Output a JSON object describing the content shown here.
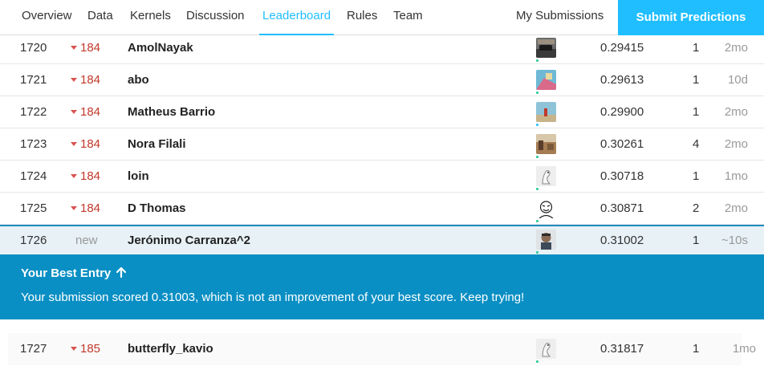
{
  "nav": {
    "tabs": [
      {
        "label": "Overview"
      },
      {
        "label": "Data"
      },
      {
        "label": "Kernels"
      },
      {
        "label": "Discussion"
      },
      {
        "label": "Leaderboard"
      },
      {
        "label": "Rules"
      },
      {
        "label": "Team"
      }
    ],
    "my_submissions": "My Submissions",
    "submit": "Submit Predictions",
    "active_tab": "Leaderboard"
  },
  "rows": [
    {
      "rank": "1720",
      "delta": "184",
      "team": "AmolNayak",
      "score": "0.29415",
      "entries": "1",
      "last": "2mo"
    },
    {
      "rank": "1721",
      "delta": "184",
      "team": "abo",
      "score": "0.29613",
      "entries": "1",
      "last": "10d"
    },
    {
      "rank": "1722",
      "delta": "184",
      "team": "Matheus Barrio",
      "score": "0.29900",
      "entries": "1",
      "last": "2mo"
    },
    {
      "rank": "1723",
      "delta": "184",
      "team": "Nora Filali",
      "score": "0.30261",
      "entries": "4",
      "last": "2mo"
    },
    {
      "rank": "1724",
      "delta": "184",
      "team": "loin",
      "score": "0.30718",
      "entries": "1",
      "last": "1mo"
    },
    {
      "rank": "1725",
      "delta": "184",
      "team": "D Thomas",
      "score": "0.30871",
      "entries": "2",
      "last": "2mo"
    }
  ],
  "my_row": {
    "rank": "1726",
    "delta": "new",
    "team": "Jerónimo Carranza^2",
    "score": "0.31002",
    "entries": "1",
    "last": "~10s"
  },
  "banner": {
    "title": "Your Best Entry",
    "message": "Your submission scored 0.31003, which is not an improvement of your best score. Keep trying!"
  },
  "next_row": {
    "rank": "1727",
    "delta": "185",
    "team": "butterfly_kavio",
    "score": "0.31817",
    "entries": "1",
    "last": "1mo"
  },
  "colors": {
    "accent": "#20beff",
    "banner": "#0a8fc4",
    "down": "#d9534f"
  }
}
